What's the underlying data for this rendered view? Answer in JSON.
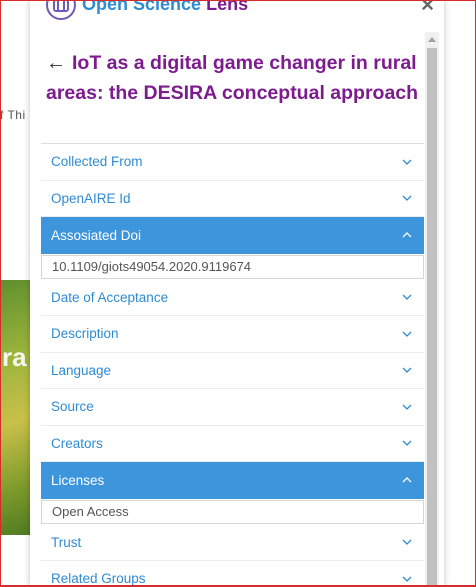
{
  "background": {
    "text_snippet": "f Thi",
    "image_text": "ra"
  },
  "header": {
    "brand_part1": "Open Science",
    "brand_part2": "Lens",
    "close_label": "×"
  },
  "record": {
    "back_label": "←",
    "title": "IoT as a digital game changer in rural areas: the DESIRA conceptual approach"
  },
  "fields": [
    {
      "label": "Collected From",
      "expanded": false
    },
    {
      "label": "OpenAIRE Id",
      "expanded": false
    },
    {
      "label": "Assosiated Doi",
      "expanded": true,
      "value": "10.1109/giots49054.2020.9119674"
    },
    {
      "label": "Date of Acceptance",
      "expanded": false
    },
    {
      "label": "Description",
      "expanded": false
    },
    {
      "label": "Language",
      "expanded": false
    },
    {
      "label": "Source",
      "expanded": false
    },
    {
      "label": "Creators",
      "expanded": false
    },
    {
      "label": "Licenses",
      "expanded": true,
      "value": "Open Access"
    },
    {
      "label": "Trust",
      "expanded": false
    },
    {
      "label": "Related Groups",
      "expanded": false
    }
  ],
  "colors": {
    "accent_blue": "#3d95dc",
    "link_blue": "#2f8bd3",
    "title_purple": "#7d1c8f",
    "frame_red": "#d42b2b"
  },
  "icons": {
    "logo": "open-science-lens-logo-icon",
    "close": "close-icon",
    "back": "back-arrow-icon",
    "collapsed": "chevron-down-icon",
    "expanded": "chevron-up-icon"
  }
}
